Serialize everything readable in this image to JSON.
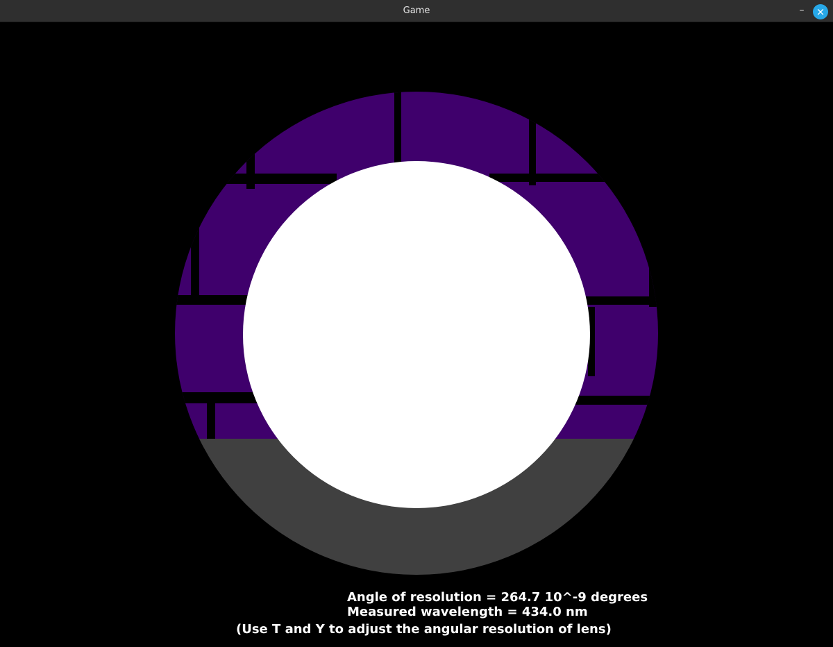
{
  "window": {
    "title": "Game",
    "minimize_icon": "minimize-icon",
    "close_icon": "close-icon",
    "minimize_glyph": "–",
    "close_glyph": "×"
  },
  "scene": {
    "sky_color": "#3f006c",
    "ground_color": "#404040",
    "background_color": "#000000",
    "lens_color": "#ffffff"
  },
  "hud": {
    "angle_line": "Angle of resolution = 264.7 10^-9 degrees",
    "wavelength_line": "Measured wavelength = 434.0 nm",
    "instruction_line": "(Use T and Y to adjust the angular resolution of lens)"
  }
}
